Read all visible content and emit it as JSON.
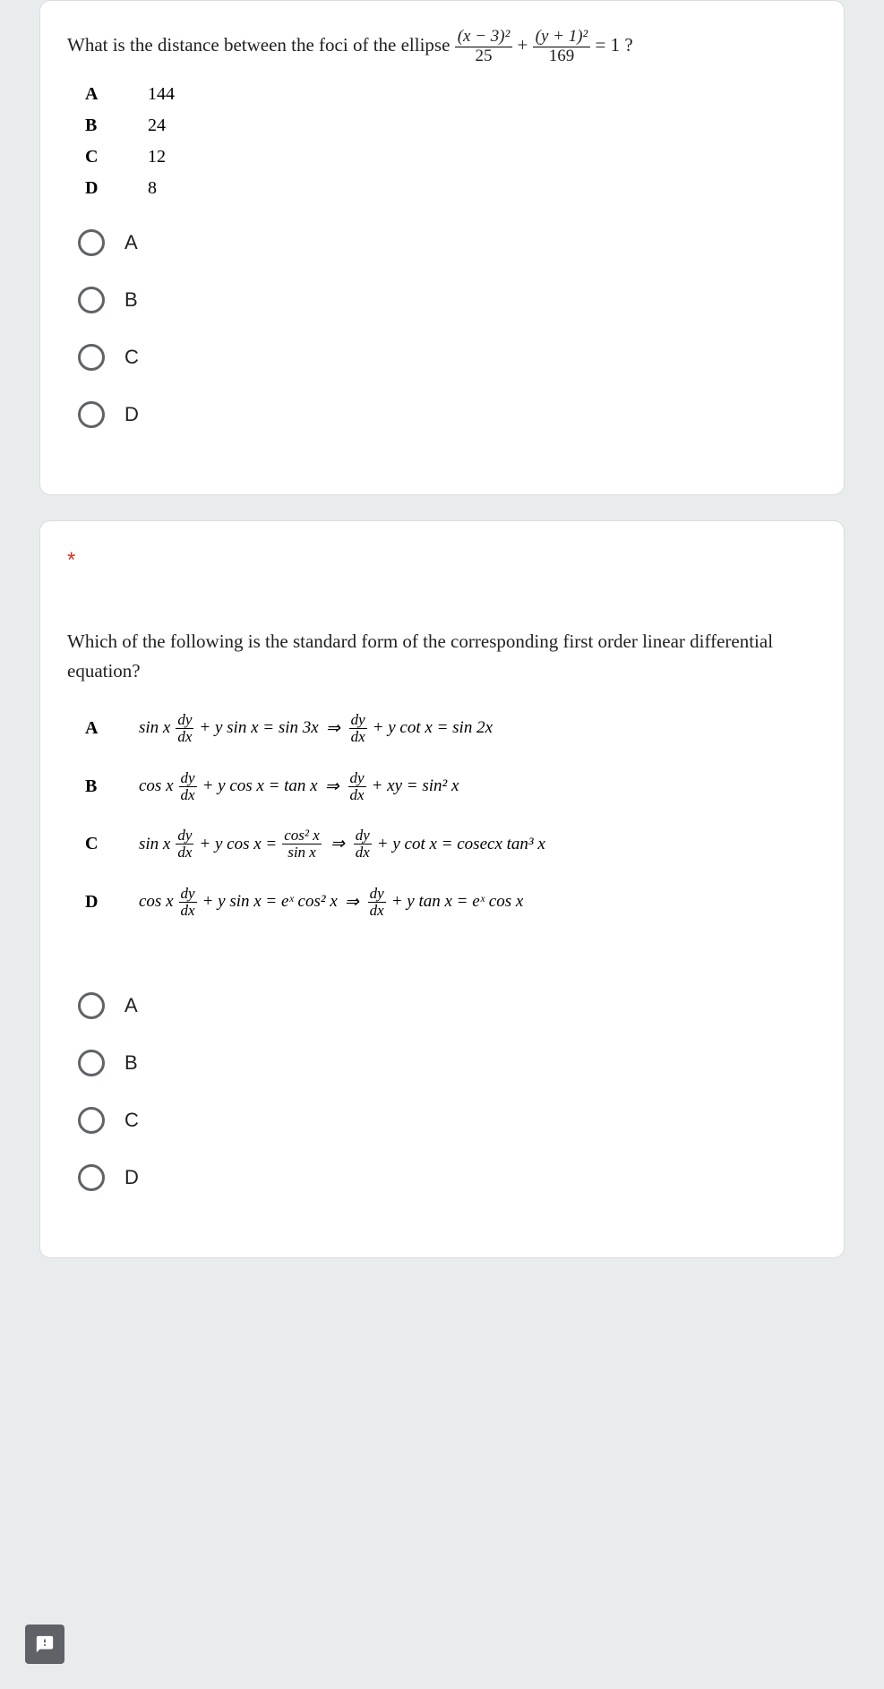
{
  "q1": {
    "prompt_prefix": "What is the distance between the foci of the ellipse ",
    "frac1_num": "(x − 3)²",
    "frac1_den": "25",
    "plus": " + ",
    "frac2_num": "(y + 1)²",
    "frac2_den": "169",
    "suffix": " = 1 ?",
    "answers": {
      "A": "144",
      "B": "24",
      "C": "12",
      "D": "8"
    },
    "options": {
      "A": "A",
      "B": "B",
      "C": "C",
      "D": "D"
    }
  },
  "q2": {
    "required_marker": "*",
    "prompt": "Which of the following is the standard form of the corresponding first order linear differential equation?",
    "rows": {
      "A": {
        "label": "A",
        "left_coeff": "sin x",
        "left_plus_term": " + y sin x = sin 3x",
        "right_plus_term": " + y cot x = sin 2x"
      },
      "B": {
        "label": "B",
        "left_coeff": "cos x",
        "left_plus_term": " + y cos x = tan x",
        "right_plus_term": " + xy = sin² x"
      },
      "C": {
        "label": "C",
        "left_coeff": "sin x",
        "left_plus_term": " + y cos x = ",
        "mid_frac_num": "cos² x",
        "mid_frac_den": "sin x",
        "right_plus_term": " + y cot x = cosecx tan³ x"
      },
      "D": {
        "label": "D",
        "left_coeff": "cos x",
        "left_plus_term": " + y sin x = eˣ cos² x",
        "right_plus_term": " + y tan x = eˣ cos x"
      }
    },
    "options": {
      "A": "A",
      "B": "B",
      "C": "C",
      "D": "D"
    }
  },
  "dy": "dy",
  "dx": "dx",
  "arrow": "⇒"
}
